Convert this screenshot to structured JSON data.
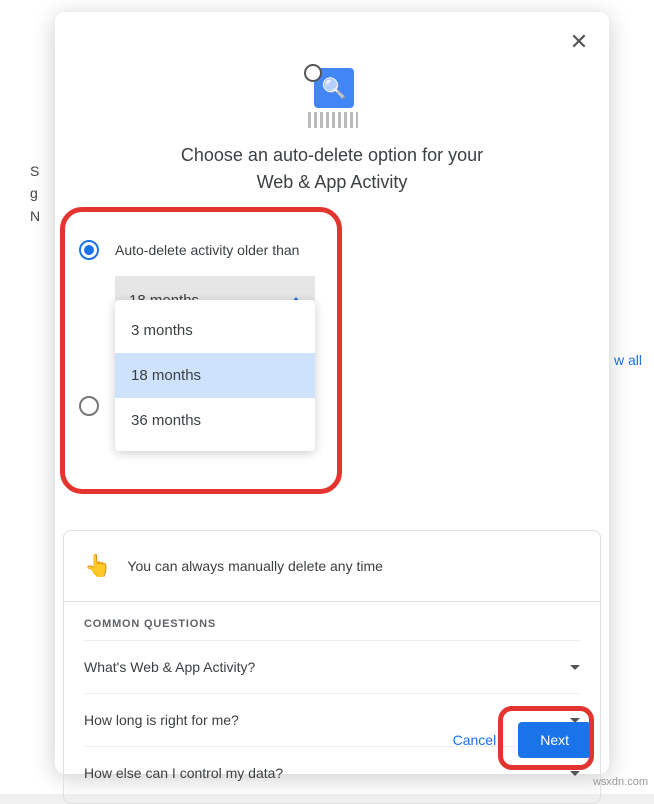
{
  "dialog": {
    "heading_line1": "Choose an auto-delete option for your",
    "heading_line2": "Web & App Activity",
    "option1": {
      "label": "Auto-delete activity older than",
      "selected_value": "18 months"
    },
    "dropdown_options": [
      "3 months",
      "18 months",
      "36 months"
    ],
    "info_text": "You can always manually delete any time",
    "common_header": "COMMON QUESTIONS",
    "questions": [
      "What's Web & App Activity?",
      "How long is right for me?",
      "How else can I control my data?"
    ],
    "cancel_label": "Cancel",
    "next_label": "Next"
  },
  "background": {
    "show_all_label": "w all"
  },
  "watermark": "wsxdn.com"
}
